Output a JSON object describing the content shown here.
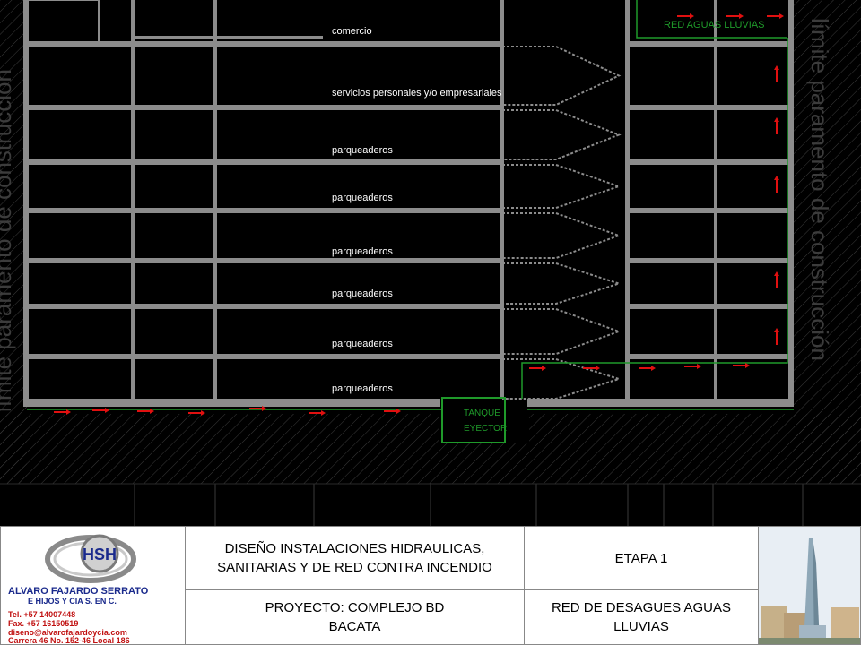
{
  "drawing": {
    "floor_labels": [
      "comercio",
      "servicios personales y/o empresariales",
      "parqueaderos",
      "parqueaderos",
      "parqueaderos",
      "parqueaderos",
      "parqueaderos",
      "parqueaderos"
    ],
    "rain_network_label": "RED AGUAS LLUVIAS",
    "tank_label_1": "TANQUE",
    "tank_label_2": "EYECTOR",
    "left_margin_text": "límite paramento de construcción",
    "right_margin_text": "límite paramento de construcción",
    "colors": {
      "background": "#000000",
      "structure": "#8c8c8c",
      "pipe": "#1f9a2a",
      "arrow": "#e01010",
      "label": "#ffffff"
    }
  },
  "title_block": {
    "company": {
      "name_line_1": "ALVARO FAJARDO SERRATO",
      "name_line_2": "E HIJOS Y CIA S. EN C.",
      "tel": "Tel. +57 14007448",
      "fax": "Fax. +57 16150519",
      "email": "diseno@alvarofajardoycia.com",
      "address": "Carrera 46 No. 152-46 Local 186",
      "logo_mark": "HSH"
    },
    "project_title": "DISEÑO INSTALACIONES HIDRAULICAS,\nSANITARIAS Y DE RED CONTRA INCENDIO",
    "stage": "ETAPA 1",
    "project_name": "PROYECTO: COMPLEJO BD\nBACATA",
    "sheet_title": "RED DE DESAGUES AGUAS\nLLUVIAS"
  }
}
